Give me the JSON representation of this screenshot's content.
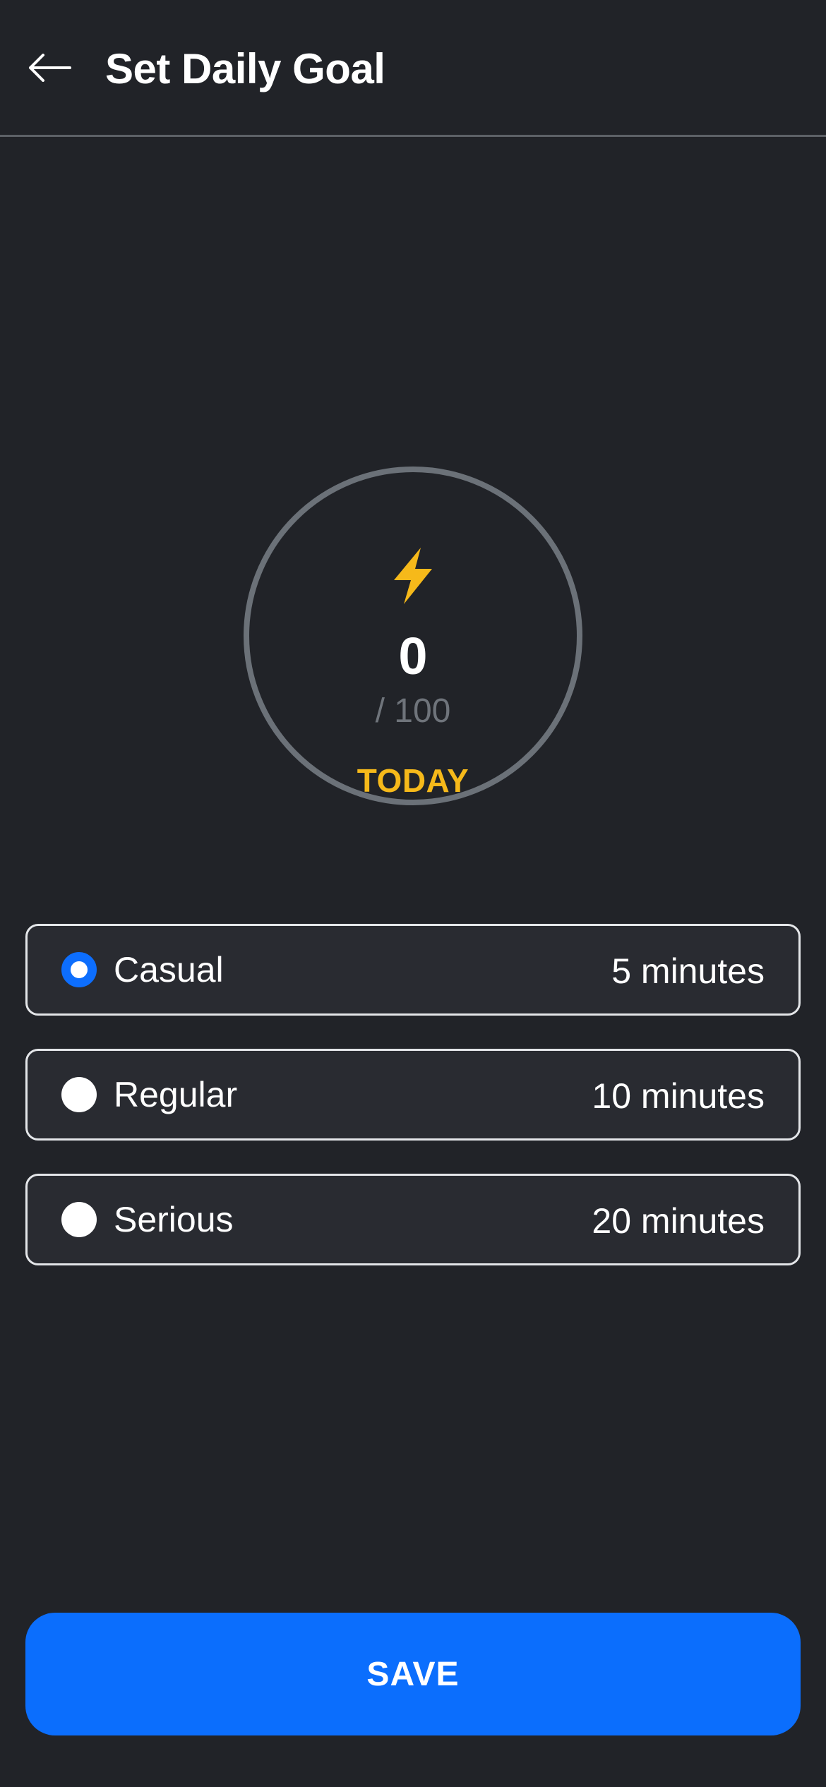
{
  "header": {
    "back_icon": "arrow-left-icon",
    "title": "Set Daily Goal"
  },
  "progress": {
    "icon": "lightning-bolt-icon",
    "value": "0",
    "total": "/ 100",
    "label": "TODAY"
  },
  "options": [
    {
      "label": "Casual",
      "duration": "5 minutes",
      "selected": true
    },
    {
      "label": "Regular",
      "duration": "10 minutes",
      "selected": false
    },
    {
      "label": "Serious",
      "duration": "20 minutes",
      "selected": false
    }
  ],
  "save_label": "SAVE",
  "colors": {
    "background": "#212328",
    "accent": "#0B6EFD",
    "highlight": "#F6B91A",
    "ring": "#6B7178"
  }
}
